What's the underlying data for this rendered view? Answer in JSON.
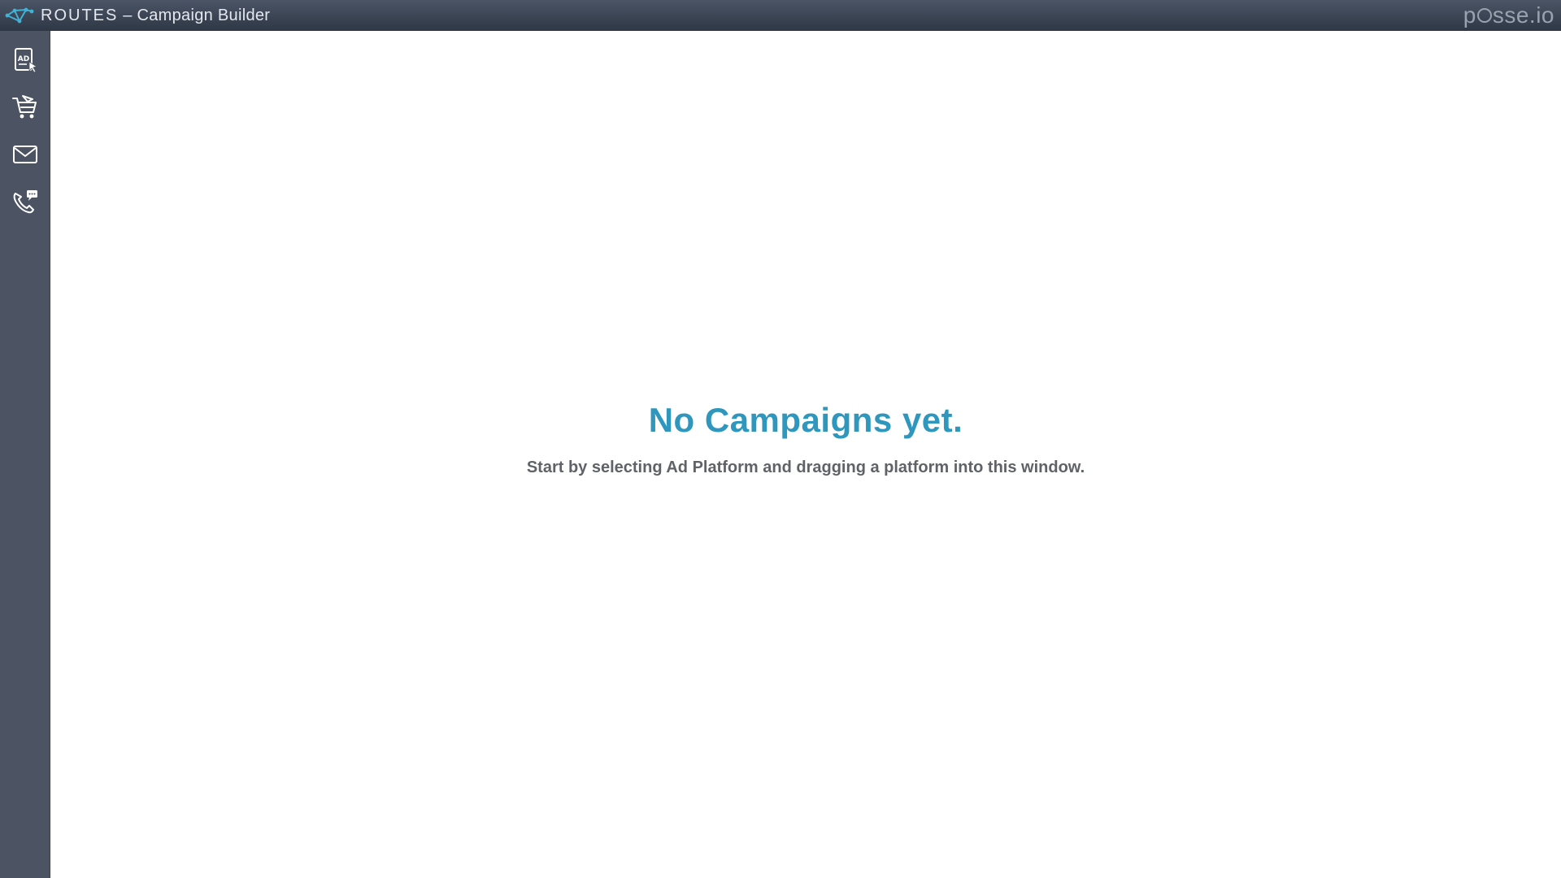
{
  "titlebar": {
    "logo_icon": "routes-logo-icon",
    "brand": "ROUTES",
    "separator": " – ",
    "title": "Campaign Builder",
    "brand_logo": {
      "prefix": "p",
      "middle": "sse.",
      "suffix": "io"
    }
  },
  "sidebar": {
    "items": [
      {
        "icon": "ad-icon",
        "name": "Ad Platform"
      },
      {
        "icon": "cart-icon",
        "name": "Commerce"
      },
      {
        "icon": "mail-icon",
        "name": "Email"
      },
      {
        "icon": "phone-chat-icon",
        "name": "Phone / SMS"
      }
    ]
  },
  "main": {
    "empty_title": "No Campaigns yet.",
    "empty_text": "Start by selecting Ad Platform and dragging a platform into this window."
  },
  "colors": {
    "titlebar_top": "#4b5566",
    "titlebar_bottom": "#2e3745",
    "sidebar": "#4c5463",
    "accent": "#2f97bd",
    "body_text": "#5f6367"
  }
}
